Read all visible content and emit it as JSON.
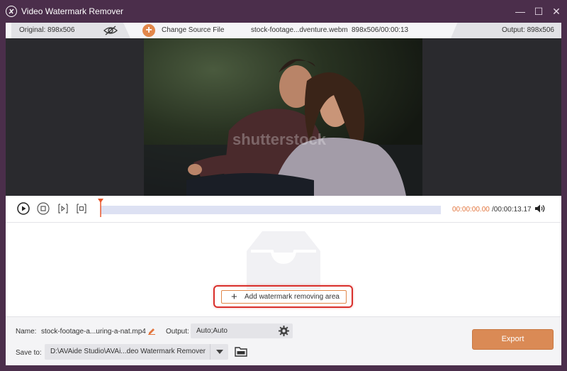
{
  "app": {
    "title": "Video Watermark Remover",
    "window_controls": {
      "minimize": "—",
      "maximize": "☐",
      "close": "✕"
    }
  },
  "infobar": {
    "original_label": "Original: 898x506",
    "change_source_label": "Change Source File",
    "file_name": "stock-footage...dventure.webm",
    "file_info": "898x506/00:00:13",
    "output_label": "Output: 898x506"
  },
  "video": {
    "watermark_text": "shutterstock"
  },
  "playback": {
    "current_time": "00:00:00.00",
    "total_time": "/00:00:13.17",
    "progress": 0.0
  },
  "work_area": {
    "add_area_label": "Add watermark removing area"
  },
  "bottom": {
    "name_label": "Name:",
    "name_value": "stock-footage-a...uring-a-nat.mp4",
    "output_label": "Output:",
    "output_value": "Auto;Auto",
    "save_to_label": "Save to:",
    "save_to_value": "D:\\AVAide Studio\\AVAi...deo Watermark Remover",
    "export_label": "Export"
  },
  "colors": {
    "title_bar": "#4b2e4b",
    "accent": "#da8a55",
    "time_current": "#e2753d",
    "highlight_outline": "#d9302c",
    "timeline": "#dde1f3"
  }
}
